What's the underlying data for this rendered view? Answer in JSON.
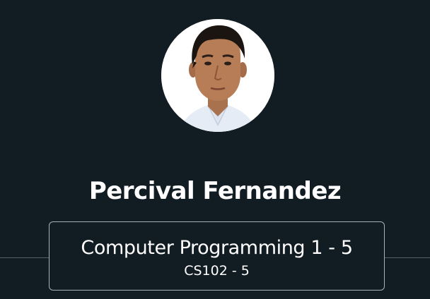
{
  "profile": {
    "name": "Percival Fernandez",
    "avatar_icon": "user-photo"
  },
  "course": {
    "title": "Computer Programming 1 - 5",
    "code": "CS102 - 5"
  },
  "colors": {
    "background": "#121c23",
    "text": "#ffffff",
    "card_border": "#a9b1b8",
    "divider": "#56606a"
  }
}
